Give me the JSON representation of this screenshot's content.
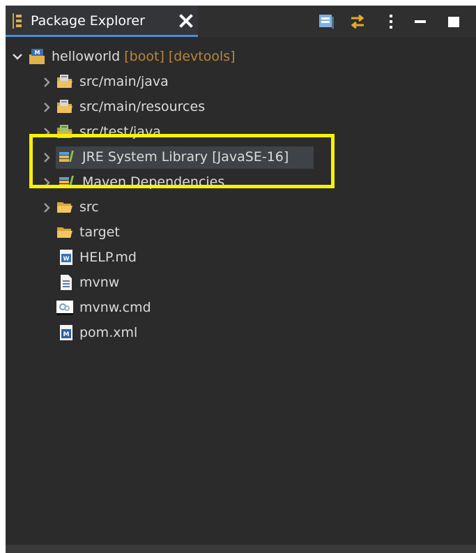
{
  "view": {
    "tab_title": "Package Explorer",
    "tab_icon": "package-explorer-icon",
    "close_icon": "close-icon",
    "toolbar": [
      {
        "name": "collapse-all-icon"
      },
      {
        "name": "link-with-editor-icon"
      },
      {
        "name": "view-menu-icon"
      },
      {
        "name": "minimize-icon"
      },
      {
        "name": "maximize-icon"
      }
    ]
  },
  "tree": {
    "project": {
      "name": "helloworld",
      "decorations": " [boot] [devtools]",
      "icon": "maven-project-icon"
    },
    "items": [
      {
        "label": "src/main/java",
        "icon": "source-folder-icon"
      },
      {
        "label": "src/main/resources",
        "icon": "source-folder-icon"
      },
      {
        "label": "src/test/java",
        "icon": "test-source-folder-icon"
      },
      {
        "label": "JRE System Library [JavaSE-16]",
        "icon": "library-icon"
      },
      {
        "label": "Maven Dependencies",
        "icon": "library-icon"
      },
      {
        "label": "src",
        "icon": "folder-icon"
      },
      {
        "label": "target",
        "icon": "folder-icon"
      },
      {
        "label": "HELP.md",
        "icon": "word-file-icon"
      },
      {
        "label": "mvnw",
        "icon": "text-file-icon"
      },
      {
        "label": "mvnw.cmd",
        "icon": "cmd-file-icon"
      },
      {
        "label": "pom.xml",
        "icon": "maven-pom-icon"
      }
    ]
  },
  "colors": {
    "background": "#2b2b2b",
    "highlight_box": "#f7f200",
    "decoration_text": "#b8863b",
    "tab_underline": "#4a8fd6"
  }
}
